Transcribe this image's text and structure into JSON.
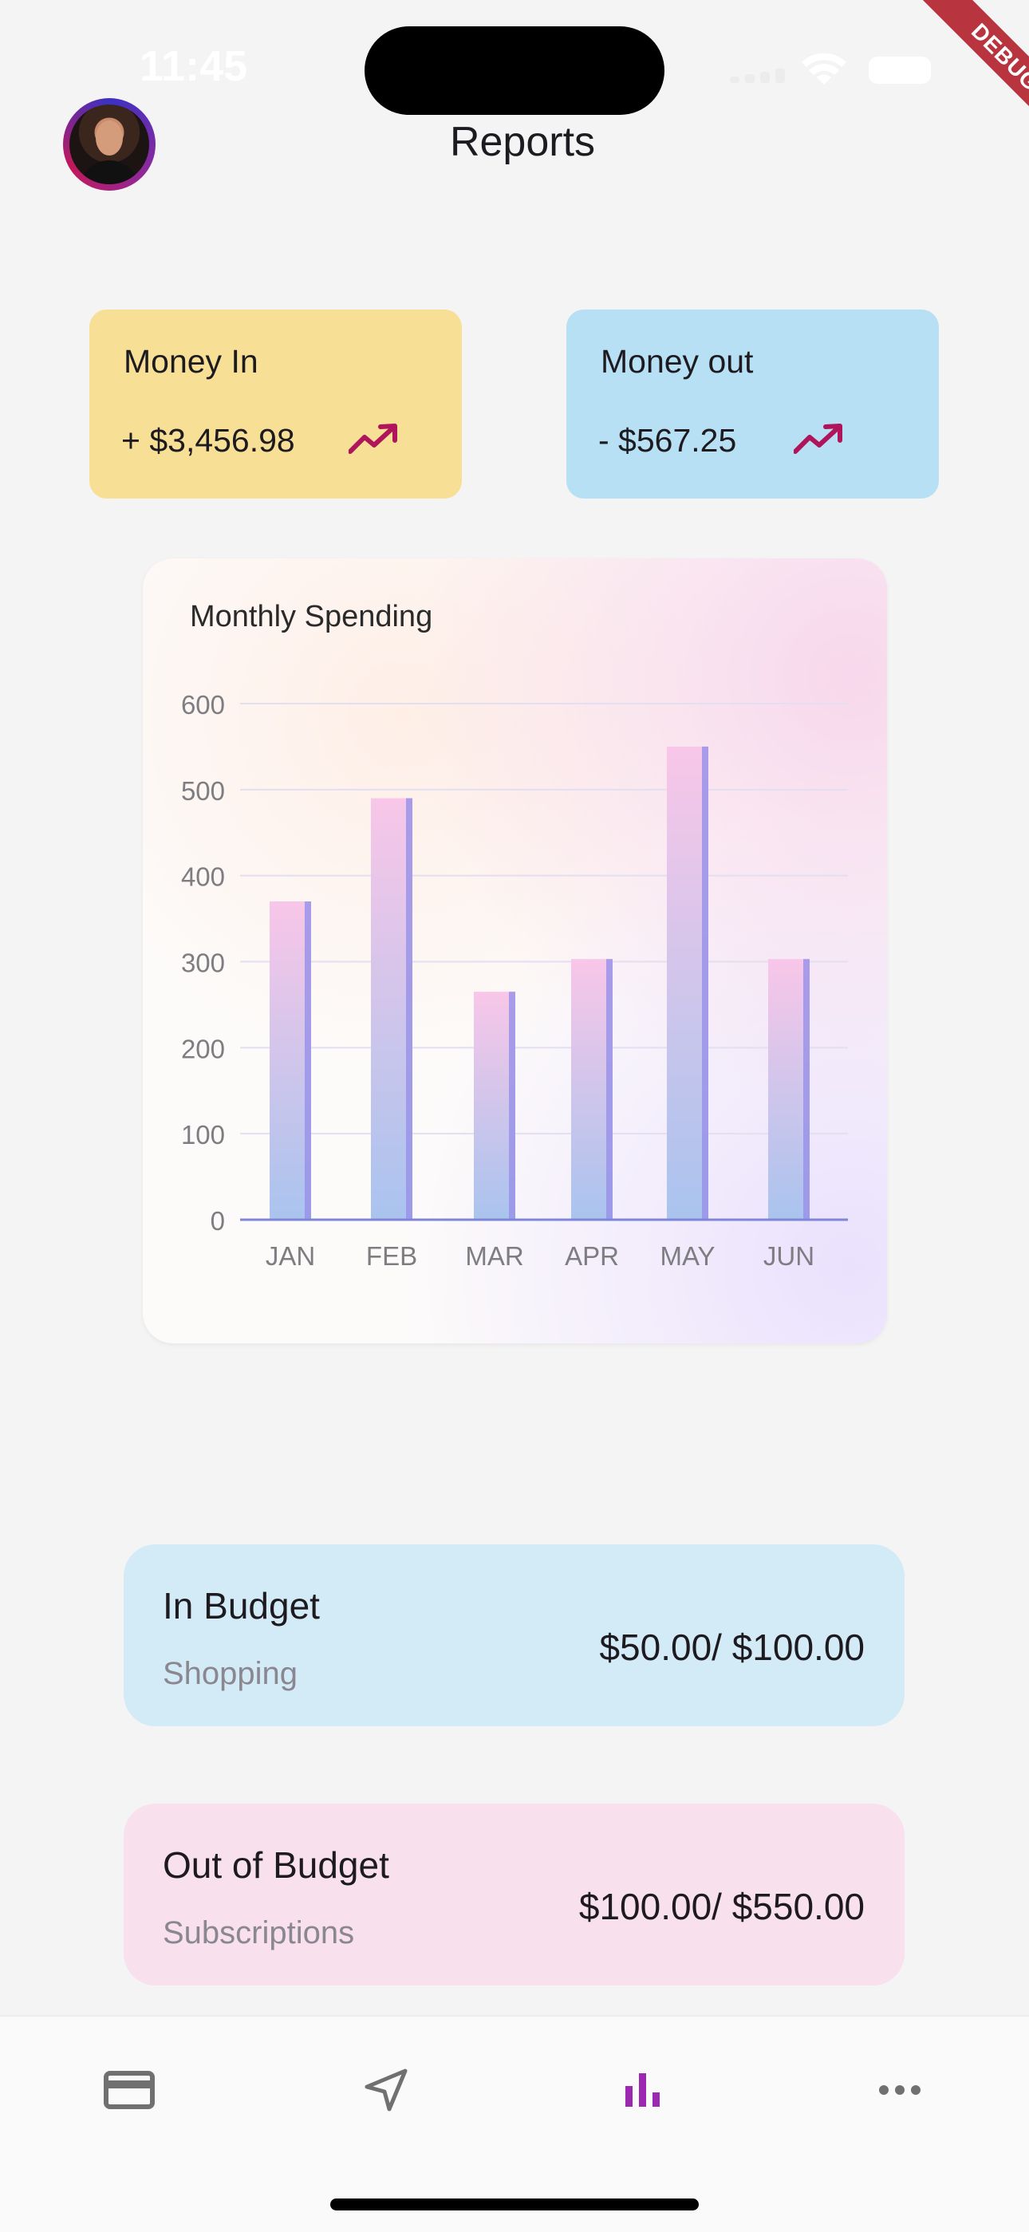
{
  "status_bar": {
    "time": "11:45"
  },
  "debug_banner": "DEBUG",
  "header": {
    "title": "Reports"
  },
  "money_in": {
    "label": "Money In",
    "amount": "+ $3,456.98",
    "trend_color": "#b0155b",
    "bg": "#f7e095"
  },
  "money_out": {
    "label": "Money out",
    "amount": "- $567.25",
    "trend_color": "#b0155b",
    "bg": "#b8e0f4"
  },
  "chart_data": {
    "type": "bar",
    "title": "Monthly Spending",
    "xlabel": "",
    "ylabel": "",
    "categories": [
      "JAN",
      "FEB",
      "MAR",
      "APR",
      "MAY",
      "JUN"
    ],
    "values": [
      370,
      490,
      265,
      303,
      550,
      303
    ],
    "ylim": [
      0,
      600
    ],
    "yticks": [
      0,
      100,
      200,
      300,
      400,
      500,
      600
    ],
    "grid": true,
    "legend": "none",
    "bar_gradient": [
      "#f8c6e8",
      "#a9c4ee"
    ],
    "bar_edge_color": "#9a93e9"
  },
  "budgets": [
    {
      "title": "In Budget",
      "category": "Shopping",
      "amount": "$50.00/ $100.00",
      "bg": "#d3eaf7"
    },
    {
      "title": "Out of Budget",
      "category": "Subscriptions",
      "amount": "$100.00/ $550.00",
      "bg": "#f8e0ed"
    }
  ],
  "nav": {
    "items": [
      {
        "name": "card-icon",
        "active": false
      },
      {
        "name": "send-icon",
        "active": false
      },
      {
        "name": "bar-chart-icon",
        "active": true
      },
      {
        "name": "more-icon",
        "active": false
      }
    ],
    "active_color": "#9c27b0",
    "inactive_color": "#707070"
  }
}
